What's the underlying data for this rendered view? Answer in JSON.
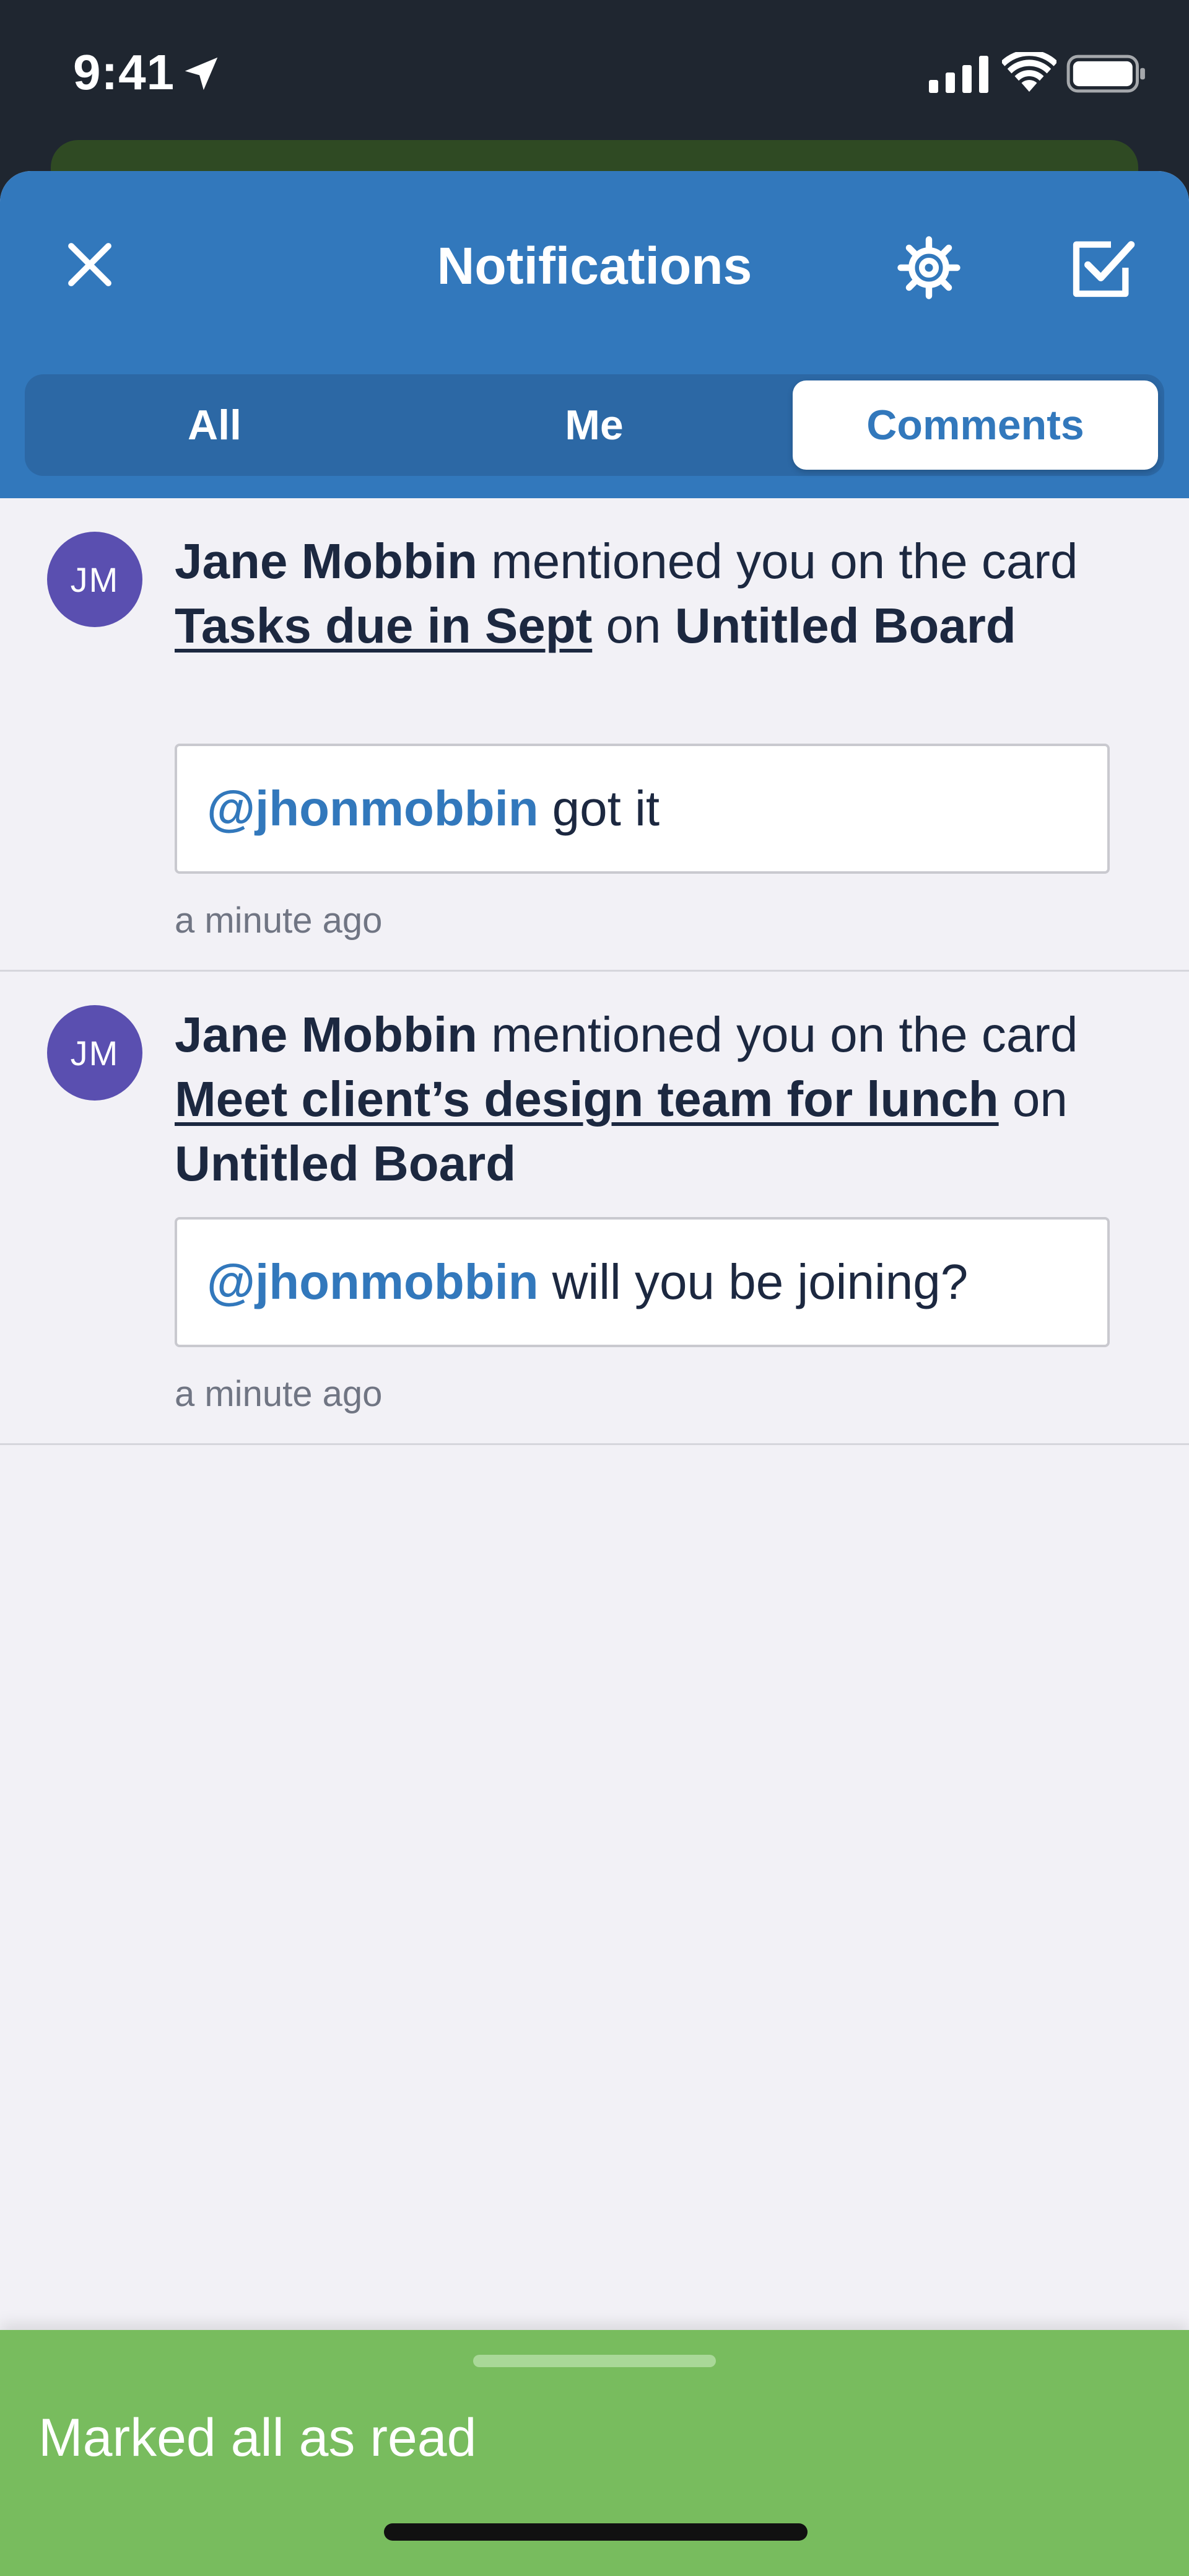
{
  "status_bar": {
    "time": "9:41",
    "icons": [
      "location-arrow-icon",
      "cellular-signal-icon",
      "wifi-icon",
      "battery-icon"
    ]
  },
  "header": {
    "title": "Notifications",
    "close_icon": "close-icon",
    "settings_icon": "gear-icon",
    "mark_all_icon": "checkbox-check-icon"
  },
  "tabs": {
    "items": [
      {
        "label": "All"
      },
      {
        "label": "Me"
      },
      {
        "label": "Comments"
      }
    ],
    "selected": "Comments"
  },
  "notifications": [
    {
      "avatar_initials": "JM",
      "user": "Jane Mobbin",
      "text_before_card": " mentioned you on the card ",
      "card": "Tasks due in Sept",
      "text_before_board": " on ",
      "board": "Untitled Board",
      "comment_mention": "@jhonmobbin",
      "comment_text": "got it",
      "time": "a minute ago"
    },
    {
      "avatar_initials": "JM",
      "user": "Jane Mobbin",
      "text_before_card": " mentioned you on the card ",
      "card": "Meet client’s design team for lunch",
      "text_before_board": " on ",
      "board": "Untitled Board",
      "comment_mention": "@jhonmobbin",
      "comment_text": "will you be joining?",
      "time": "a minute ago"
    }
  ],
  "toast": {
    "message": "Marked all as read"
  },
  "colors": {
    "header_blue": "#3278bc",
    "tab_track": "#2c68a5",
    "avatar_purple": "#5a4fb0",
    "toast_green": "#78bc5e",
    "text_dark": "#1c2840",
    "sheet_bg": "#f2f1f6"
  }
}
